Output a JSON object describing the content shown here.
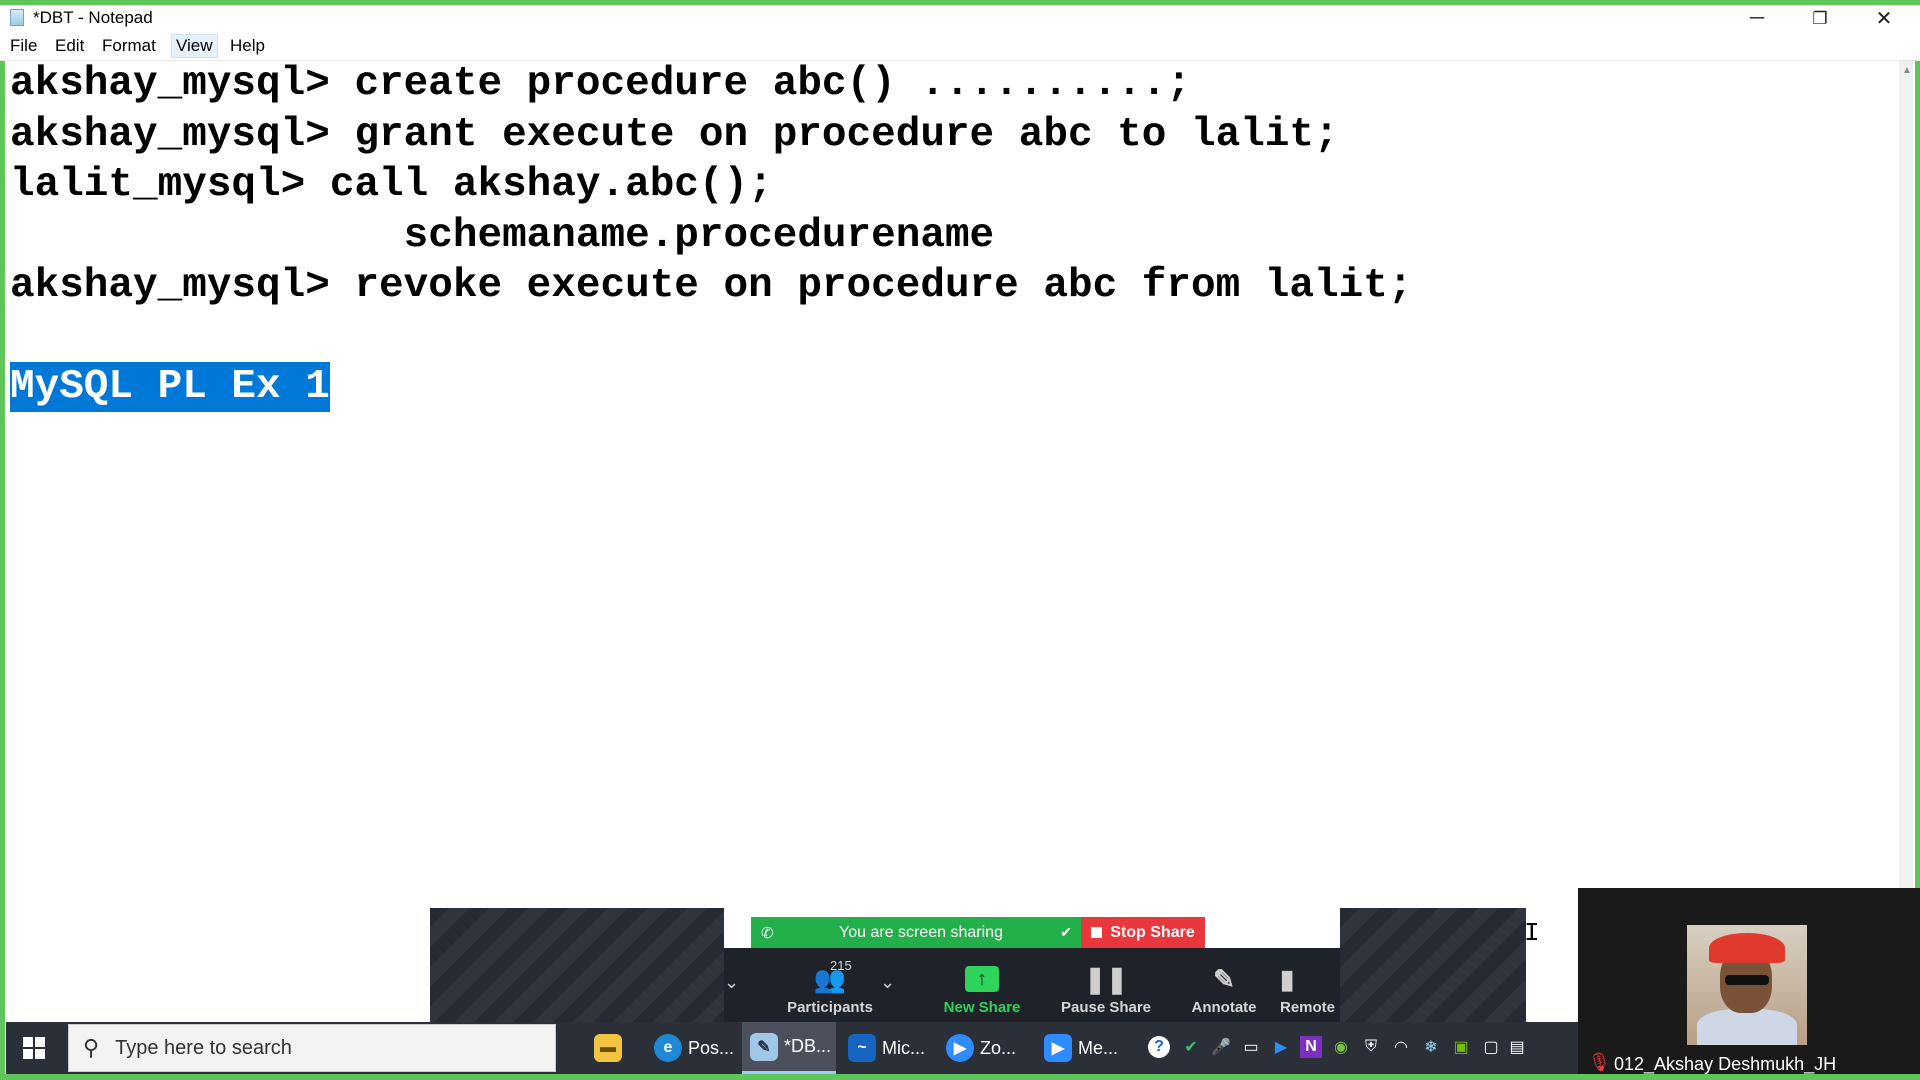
{
  "window": {
    "title": "*DBT - Notepad",
    "minimize_glyph": "─",
    "restore_glyph": "❐",
    "close_glyph": "✕"
  },
  "menu": [
    {
      "label": "File"
    },
    {
      "label": "Edit"
    },
    {
      "label": "Format"
    },
    {
      "label": "View"
    },
    {
      "label": "Help"
    }
  ],
  "editor": {
    "lines": [
      "akshay_mysql> create procedure abc() ..........;",
      "akshay_mysql> grant execute on procedure abc to lalit;",
      "lalit_mysql> call akshay.abc();",
      "                schemaname.procedurename",
      "akshay_mysql> revoke execute on procedure abc from lalit;"
    ],
    "selected_text": "MySQL PL Ex 1"
  },
  "zoom": {
    "sharing_label": "You are screen sharing",
    "stop_share_label": "Stop Share",
    "participants_count": "215",
    "buttons": [
      {
        "label": "Participants"
      },
      {
        "label": "New Share"
      },
      {
        "label": "Pause Share"
      },
      {
        "label": "Annotate"
      },
      {
        "label": "Remote"
      }
    ],
    "accent_green": "#23b04a",
    "stop_red": "#e8383d"
  },
  "webcam": {
    "participant_name": "012_Akshay Deshmukh_JH"
  },
  "taskbar": {
    "search_placeholder": "Type here to search",
    "apps": [
      {
        "label": "",
        "icon": "file-explorer-icon"
      },
      {
        "label": "Pos...",
        "icon": "edge-icon"
      },
      {
        "label": "*DB...",
        "icon": "notepad-icon"
      },
      {
        "label": "Mic...",
        "icon": "whiteboard-icon"
      },
      {
        "label": "Zo...",
        "icon": "zoom-icon"
      },
      {
        "label": "Me...",
        "icon": "zoom-meeting-icon"
      }
    ]
  }
}
